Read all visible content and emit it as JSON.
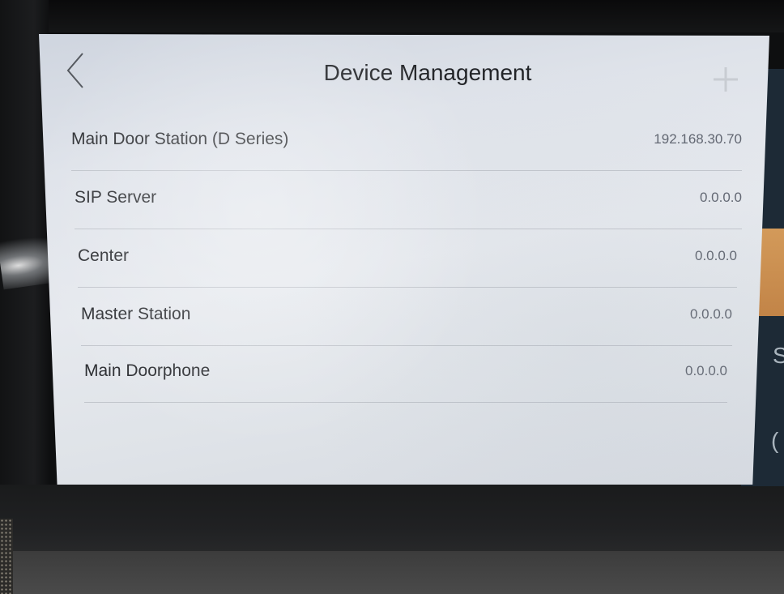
{
  "header": {
    "title": "Device Management",
    "back_icon": "chevron-left-icon",
    "add_icon": "plus-icon"
  },
  "devices": [
    {
      "name": "Main Door Station (D Series)",
      "ip": "192.168.30.70"
    },
    {
      "name": "SIP Server",
      "ip": "0.0.0.0"
    },
    {
      "name": "Center",
      "ip": "0.0.0.0"
    },
    {
      "name": "Master Station",
      "ip": "0.0.0.0"
    },
    {
      "name": "Main Doorphone",
      "ip": "0.0.0.0"
    }
  ],
  "colors": {
    "screen_background": "#e2e6ec",
    "title_text": "#222428",
    "label_text": "#2b2d31",
    "value_text": "#606570",
    "side_panel": "#1d2a36",
    "side_panel_accent": "#d39a5a"
  }
}
